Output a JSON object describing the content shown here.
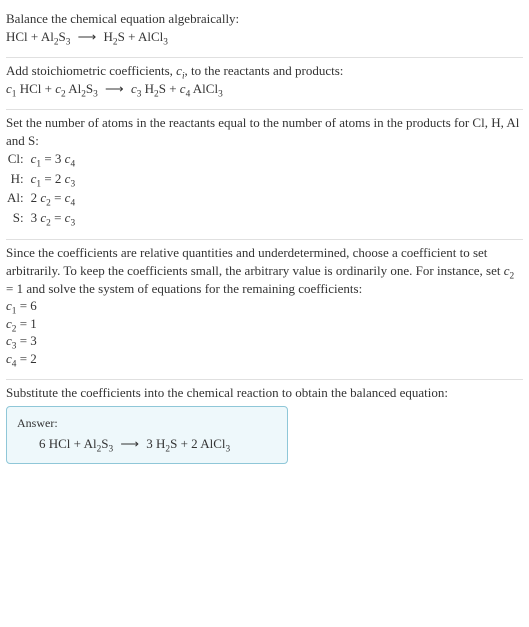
{
  "sec1": {
    "heading": "Balance the chemical equation algebraically:",
    "reaction": {
      "r1": "HCl",
      "plus1": "+",
      "r2_a": "Al",
      "r2_s1": "2",
      "r2_b": "S",
      "r2_s2": "3",
      "arrow": "⟶",
      "p1_a": "H",
      "p1_s1": "2",
      "p1_b": "S",
      "plus2": "+",
      "p2_a": "AlCl",
      "p2_s1": "3"
    }
  },
  "sec2": {
    "heading_a": "Add stoichiometric coefficients, ",
    "heading_ci_c": "c",
    "heading_ci_i": "i",
    "heading_b": ", to the reactants and products:",
    "reaction": {
      "c1c": "c",
      "c1i": "1",
      "sp1": " HCl",
      "plus1": "+",
      "c2c": "c",
      "c2i": "2",
      "sp2": " Al",
      "sp2s1": "2",
      "sp2b": "S",
      "sp2s2": "3",
      "arrow": "⟶",
      "c3c": "c",
      "c3i": "3",
      "sp3": " H",
      "sp3s1": "2",
      "sp3b": "S",
      "plus2": "+",
      "c4c": "c",
      "c4i": "4",
      "sp4": " AlCl",
      "sp4s1": "3"
    }
  },
  "sec3": {
    "heading": "Set the number of atoms in the reactants equal to the number of atoms in the products for Cl, H, Al and S:",
    "rows": [
      {
        "label": "Cl:",
        "lhs_c": "c",
        "lhs_i": "1",
        "eq": " = 3 ",
        "rhs_c": "c",
        "rhs_i": "4"
      },
      {
        "label": "H:",
        "lhs_c": "c",
        "lhs_i": "1",
        "eq": " = 2 ",
        "rhs_c": "c",
        "rhs_i": "3"
      },
      {
        "label": "Al:",
        "pre": "2 ",
        "lhs_c": "c",
        "lhs_i": "2",
        "eq": " = ",
        "rhs_c": "c",
        "rhs_i": "4"
      },
      {
        "label": "S:",
        "pre": "3 ",
        "lhs_c": "c",
        "lhs_i": "2",
        "eq": " = ",
        "rhs_c": "c",
        "rhs_i": "3"
      }
    ]
  },
  "sec4": {
    "text_a": "Since the coefficients are relative quantities and underdetermined, choose a coefficient to set arbitrarily. To keep the coefficients small, the arbitrary value is ordinarily one. For instance, set ",
    "cc": "c",
    "ci": "2",
    "ceq": " = 1",
    "text_b": " and solve the system of equations for the remaining coefficients:",
    "sol": [
      {
        "c": "c",
        "i": "1",
        "rest": " = 6"
      },
      {
        "c": "c",
        "i": "2",
        "rest": " = 1"
      },
      {
        "c": "c",
        "i": "3",
        "rest": " = 3"
      },
      {
        "c": "c",
        "i": "4",
        "rest": " = 2"
      }
    ]
  },
  "sec5": {
    "heading": "Substitute the coefficients into the chemical reaction to obtain the balanced equation:",
    "answer_label": "Answer:",
    "reaction": {
      "k1": "6 HCl",
      "plus1": "+",
      "k2a": "Al",
      "k2s1": "2",
      "k2b": "S",
      "k2s2": "3",
      "arrow": "⟶",
      "k3": "3 H",
      "k3s1": "2",
      "k3b": "S",
      "plus2": "+",
      "k4": "2 AlCl",
      "k4s1": "3"
    }
  },
  "chart_data": {
    "type": "table",
    "reaction_unbalanced": "HCl + Al2S3 -> H2S + AlCl3",
    "reaction_balanced": "6 HCl + Al2S3 -> 3 H2S + 2 AlCl3",
    "element_balance_equations": [
      {
        "element": "Cl",
        "equation": "c1 = 3 c4"
      },
      {
        "element": "H",
        "equation": "c1 = 2 c3"
      },
      {
        "element": "Al",
        "equation": "2 c2 = c4"
      },
      {
        "element": "S",
        "equation": "3 c2 = c3"
      }
    ],
    "coefficients": {
      "c1": 6,
      "c2": 1,
      "c3": 3,
      "c4": 2
    }
  }
}
